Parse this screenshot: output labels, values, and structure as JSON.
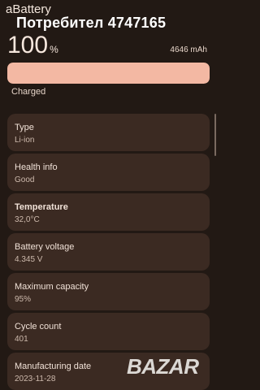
{
  "app": {
    "title": "aBattery"
  },
  "watermark": {
    "text": "Потребител 4747165"
  },
  "battery": {
    "percent_value": "100",
    "percent_sign": "%",
    "capacity": "4646 mAh",
    "level_fraction": 1.0,
    "status": "Charged"
  },
  "colors": {
    "background": "#221914",
    "card": "#3b2a22",
    "progress_fill": "#f3b8a3",
    "progress_track": "#4a372d"
  },
  "cards": [
    {
      "label": "Type",
      "value": "Li-ion"
    },
    {
      "label": "Health info",
      "value": "Good"
    },
    {
      "label": "Temperature",
      "value": "32,0°C"
    },
    {
      "label": "Battery voltage",
      "value": "4.345 V"
    },
    {
      "label": "Maximum capacity",
      "value": "95%"
    },
    {
      "label": "Cycle count",
      "value": "401"
    },
    {
      "label": "Manufacturing date",
      "value": "2023-11-28"
    }
  ],
  "logo": {
    "text": "BAZAR"
  }
}
